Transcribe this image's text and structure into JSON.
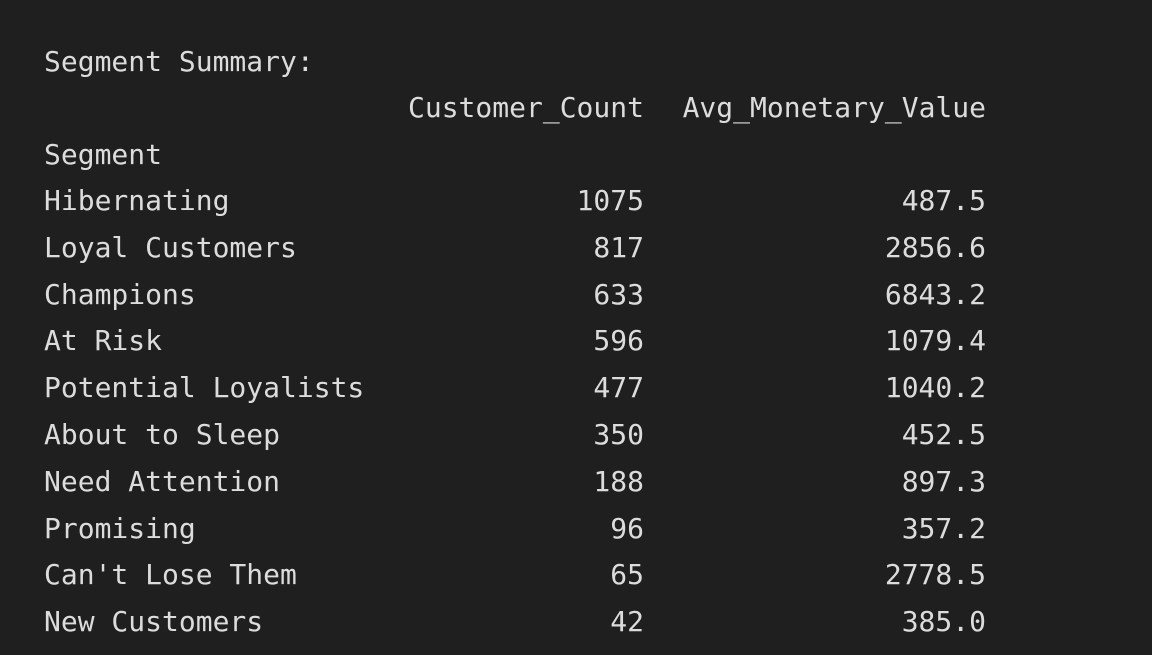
{
  "output": {
    "title": "Segment Summary:",
    "columns": {
      "customer_count": "Customer_Count",
      "avg_monetary_value": "Avg_Monetary_Value"
    },
    "index_name": "Segment",
    "rows": [
      {
        "segment": "Hibernating",
        "customer_count": "1075",
        "avg_monetary_value": "487.5"
      },
      {
        "segment": "Loyal Customers",
        "customer_count": "817",
        "avg_monetary_value": "2856.6"
      },
      {
        "segment": "Champions",
        "customer_count": "633",
        "avg_monetary_value": "6843.2"
      },
      {
        "segment": "At Risk",
        "customer_count": "596",
        "avg_monetary_value": "1079.4"
      },
      {
        "segment": "Potential Loyalists",
        "customer_count": "477",
        "avg_monetary_value": "1040.2"
      },
      {
        "segment": "About to Sleep",
        "customer_count": "350",
        "avg_monetary_value": "452.5"
      },
      {
        "segment": "Need Attention",
        "customer_count": "188",
        "avg_monetary_value": "897.3"
      },
      {
        "segment": "Promising",
        "customer_count": "96",
        "avg_monetary_value": "357.2"
      },
      {
        "segment": "Can't Lose Them",
        "customer_count": "65",
        "avg_monetary_value": "2778.5"
      },
      {
        "segment": "New Customers",
        "customer_count": "42",
        "avg_monetary_value": "385.0"
      }
    ]
  }
}
